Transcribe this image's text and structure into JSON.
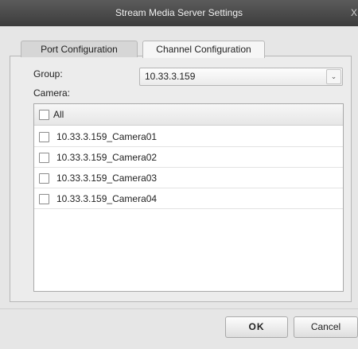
{
  "window": {
    "title": "Stream Media Server Settings",
    "close_label": "X"
  },
  "tabs": [
    {
      "label": "Port Configuration",
      "selected": false
    },
    {
      "label": "Channel Configuration",
      "selected": true
    }
  ],
  "group": {
    "label": "Group:",
    "selected_value": "10.33.3.159",
    "arrow_icon": "chevron-down-icon"
  },
  "camera": {
    "label": "Camera:",
    "all_label": "All",
    "all_checked": false,
    "items": [
      {
        "label": "10.33.3.159_Camera01",
        "checked": false
      },
      {
        "label": "10.33.3.159_Camera02",
        "checked": false
      },
      {
        "label": "10.33.3.159_Camera03",
        "checked": false
      },
      {
        "label": "10.33.3.159_Camera04",
        "checked": false
      }
    ]
  },
  "buttons": {
    "ok_label": "OK",
    "cancel_label": "Cancel"
  }
}
